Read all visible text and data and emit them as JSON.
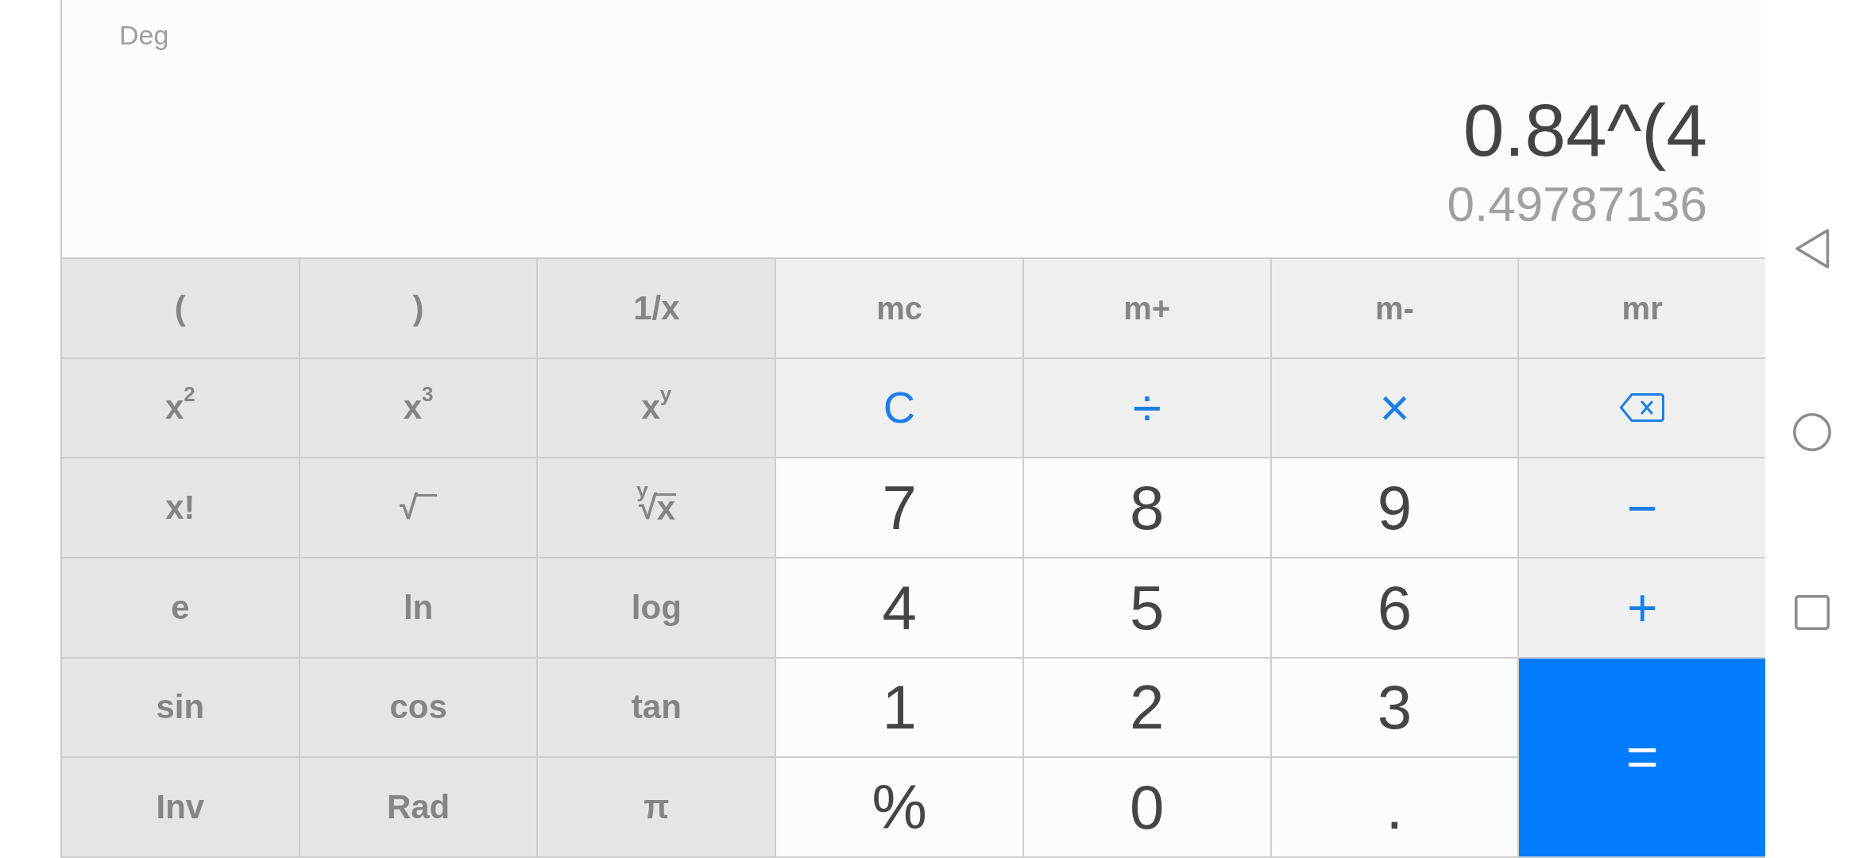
{
  "display": {
    "angle_mode": "Deg",
    "expression": "0.84^(4",
    "result": "0.49787136"
  },
  "keypad": {
    "rows": [
      [
        {
          "kind": "function",
          "label": "("
        },
        {
          "kind": "function",
          "label": ")"
        },
        {
          "kind": "function",
          "label": "1/x"
        },
        {
          "kind": "memory",
          "label": "mc"
        },
        {
          "kind": "memory",
          "label": "m+"
        },
        {
          "kind": "memory",
          "label": "m-"
        },
        {
          "kind": "memory",
          "label": "mr"
        }
      ],
      [
        {
          "kind": "function",
          "label": "x$^{2}$"
        },
        {
          "kind": "function",
          "label": "x$^{3}$"
        },
        {
          "kind": "function",
          "label": "x$^{y}$"
        },
        {
          "kind": "clear",
          "label": "C"
        },
        {
          "kind": "operator",
          "label": "÷"
        },
        {
          "kind": "operator",
          "label": "×"
        },
        {
          "kind": "backspace"
        }
      ],
      [
        {
          "kind": "function",
          "label": "x!"
        },
        {
          "kind": "radical",
          "label": "√"
        },
        {
          "kind": "radical",
          "label": "$^{y}$√",
          "radicand": "x"
        },
        {
          "kind": "digit",
          "label": "7"
        },
        {
          "kind": "digit",
          "label": "8"
        },
        {
          "kind": "digit",
          "label": "9"
        },
        {
          "kind": "operator",
          "label": "−"
        }
      ],
      [
        {
          "kind": "function",
          "label": "e"
        },
        {
          "kind": "function",
          "label": "ln"
        },
        {
          "kind": "function",
          "label": "log"
        },
        {
          "kind": "digit",
          "label": "4"
        },
        {
          "kind": "digit",
          "label": "5"
        },
        {
          "kind": "digit",
          "label": "6"
        },
        {
          "kind": "operator",
          "label": "+"
        }
      ],
      [
        {
          "kind": "function",
          "label": "sin"
        },
        {
          "kind": "function",
          "label": "cos"
        },
        {
          "kind": "function",
          "label": "tan"
        },
        {
          "kind": "digit",
          "label": "1"
        },
        {
          "kind": "digit",
          "label": "2"
        },
        {
          "kind": "digit",
          "label": "3"
        },
        {
          "kind": "equals",
          "label": "="
        }
      ],
      [
        {
          "kind": "function",
          "label": "Inv"
        },
        {
          "kind": "function",
          "label": "Rad"
        },
        {
          "kind": "function",
          "label": "π"
        },
        {
          "kind": "digit",
          "label": "%"
        },
        {
          "kind": "digit",
          "label": "0"
        },
        {
          "kind": "digit",
          "label": "."
        }
      ]
    ]
  },
  "nav_bar": {
    "buttons": [
      {
        "kind": "back"
      },
      {
        "kind": "home"
      },
      {
        "kind": "recents"
      }
    ]
  }
}
